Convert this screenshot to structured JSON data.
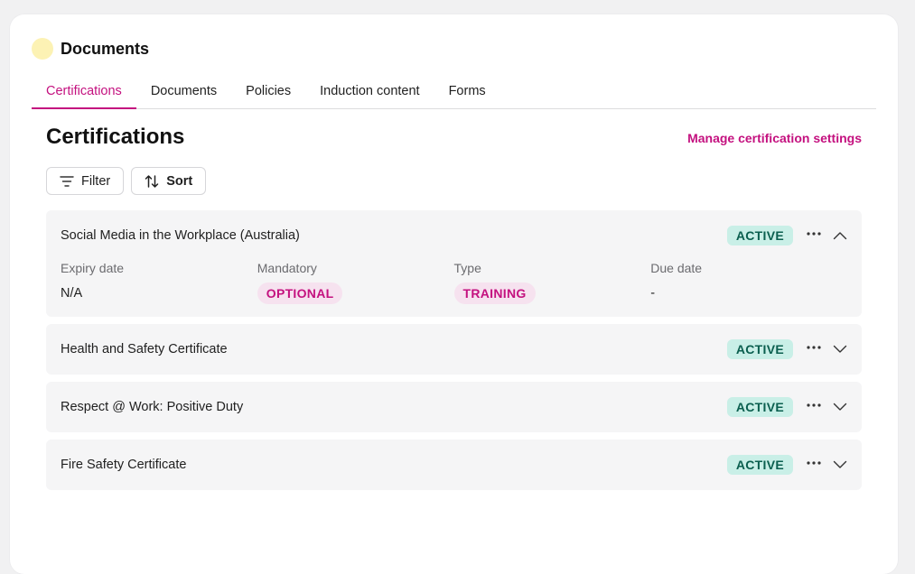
{
  "header": {
    "title": "Documents"
  },
  "tabs": [
    {
      "label": "Certifications"
    },
    {
      "label": "Documents"
    },
    {
      "label": "Policies"
    },
    {
      "label": "Induction content"
    },
    {
      "label": "Forms"
    }
  ],
  "section": {
    "title": "Certifications",
    "manage_link": "Manage certification settings"
  },
  "toolbar": {
    "filter_label": "Filter",
    "sort_label": "Sort"
  },
  "items": [
    {
      "title": "Social Media in the Workplace (Australia)",
      "status": "ACTIVE",
      "expanded": true,
      "details": {
        "expiry_label": "Expiry date",
        "expiry_value": "N/A",
        "mandatory_label": "Mandatory",
        "mandatory_value": "OPTIONAL",
        "type_label": "Type",
        "type_value": "TRAINING",
        "due_label": "Due date",
        "due_value": "-"
      }
    },
    {
      "title": "Health and Safety Certificate",
      "status": "ACTIVE",
      "expanded": false
    },
    {
      "title": "Respect @ Work: Positive Duty",
      "status": "ACTIVE",
      "expanded": false
    },
    {
      "title": "Fire Safety Certificate",
      "status": "ACTIVE",
      "expanded": false
    }
  ],
  "colors": {
    "accent": "#c4117f",
    "active_badge_bg": "#c9efe7",
    "active_badge_text": "#0b5f4f",
    "avatar": "#fcf2b4"
  },
  "icons": {
    "filter": "filter-icon",
    "sort": "sort-icon",
    "more": "more-horizontal-icon",
    "expand": "chevron-down-icon",
    "collapse": "chevron-up-icon"
  }
}
